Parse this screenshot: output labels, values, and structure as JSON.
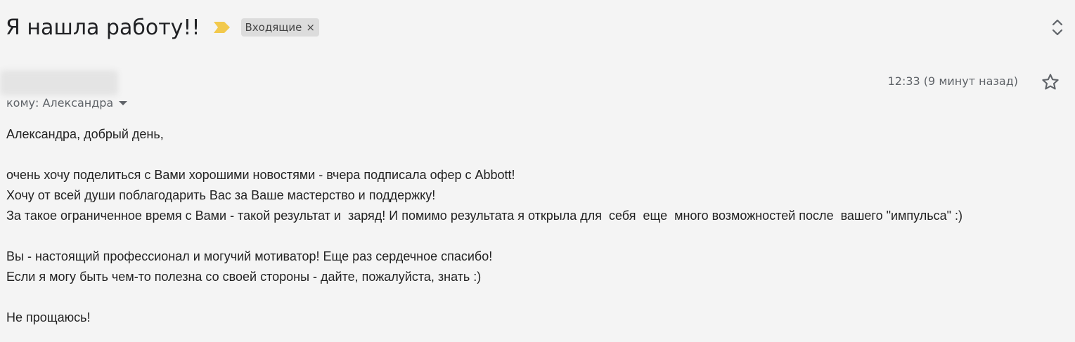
{
  "email": {
    "subject": "Я нашла работу!!",
    "label": "Входящие",
    "label_remove_glyph": "×",
    "sender_name": "",
    "recipient_line": "кому: Александра",
    "timestamp": "12:33 (9 минут назад)",
    "body_lines": [
      "Александра, добрый день,",
      "",
      "очень хочу поделиться с Вами хорошими новостями - вчера подписала офер с Abbott!",
      "Хочу от всей души поблагодарить Вас за Ваше мастерство и поддержку!",
      "За такое ограниченное время с Вами - такой результат и  заряд! И помимо результата я открыла для  себя  еще  много возможностей после  вашего \"импульса\" :)",
      "",
      "Вы - настоящий профессионал и могучий мотиватор! Еще раз сердечное спасибо!",
      "Если я могу быть чем-то полезна со своей стороны - дайте, пожалуйста, знать :)",
      "",
      "Не прощаюсь!"
    ]
  },
  "icons": {
    "importance": "importance-marker-icon",
    "expand": "unfold-icon",
    "star": "star-icon",
    "dropdown": "chevron-down-icon"
  },
  "colors": {
    "background": "#f4f4f4",
    "importance_marker": "#f2c94c",
    "label_chip_bg": "#dcdcdc",
    "secondary_text": "#5f6368",
    "body_text": "#222222"
  }
}
